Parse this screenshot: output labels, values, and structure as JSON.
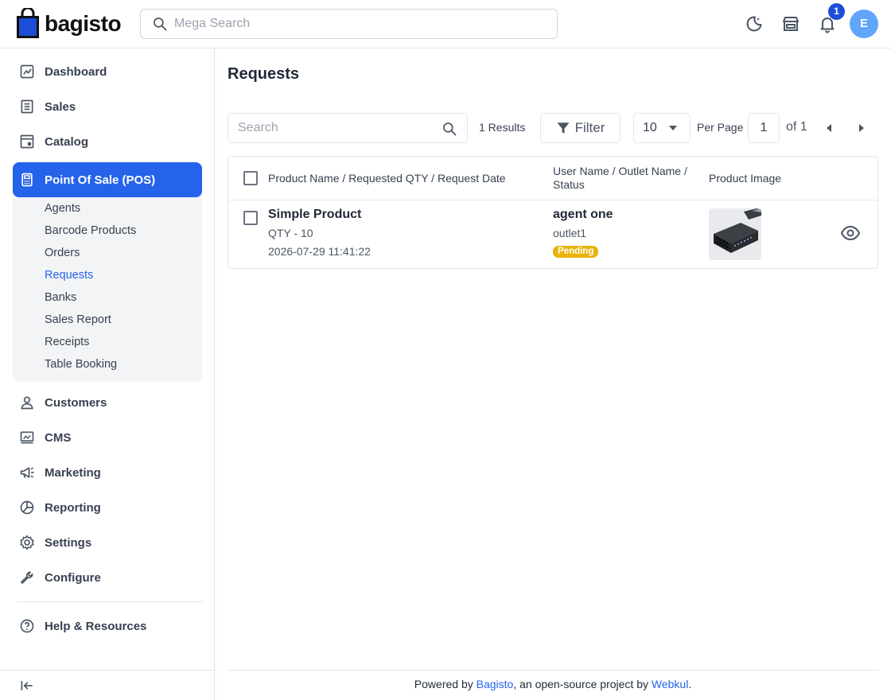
{
  "header": {
    "logo_text": "bagisto",
    "search_placeholder": "Mega Search",
    "notification_count": "1",
    "avatar_initial": "E"
  },
  "sidebar": {
    "items": [
      {
        "label": "Dashboard",
        "icon": "dashboard-icon"
      },
      {
        "label": "Sales",
        "icon": "sales-icon"
      },
      {
        "label": "Catalog",
        "icon": "catalog-icon"
      },
      {
        "label": "Point Of Sale (POS)",
        "icon": "pos-icon"
      },
      {
        "label": "Customers",
        "icon": "customers-icon"
      },
      {
        "label": "CMS",
        "icon": "cms-icon"
      },
      {
        "label": "Marketing",
        "icon": "marketing-icon"
      },
      {
        "label": "Reporting",
        "icon": "reporting-icon"
      },
      {
        "label": "Settings",
        "icon": "settings-icon"
      },
      {
        "label": "Configure",
        "icon": "configure-icon"
      },
      {
        "label": "Help & Resources",
        "icon": "help-icon"
      }
    ],
    "pos_submenu": [
      "Agents",
      "Barcode Products",
      "Orders",
      "Requests",
      "Banks",
      "Sales Report",
      "Receipts",
      "Table Booking"
    ],
    "active_submenu": "Requests",
    "accent_color": "#2563eb"
  },
  "main": {
    "title": "Requests",
    "search_placeholder": "Search",
    "results_text": "1 Results",
    "filter_label": "Filter",
    "per_page_value": "10",
    "per_page_label": "Per Page",
    "current_page": "1",
    "of_pages": "of 1",
    "columns": {
      "product": "Product Name / Requested QTY / Request Date",
      "user_line1": "User Name / Outlet Name /",
      "user_line2": "Status",
      "image": "Product Image"
    },
    "rows": [
      {
        "product_name": "Simple Product",
        "qty": "QTY - 10",
        "date": "2026-07-29 11:41:22",
        "user_name": "agent one",
        "outlet": "outlet1",
        "status": "Pending",
        "status_color": "#eab308"
      }
    ]
  },
  "footer": {
    "prefix": "Powered by ",
    "link1": "Bagisto",
    "middle": ", an open-source project by ",
    "link2": "Webkul",
    "suffix": "."
  }
}
